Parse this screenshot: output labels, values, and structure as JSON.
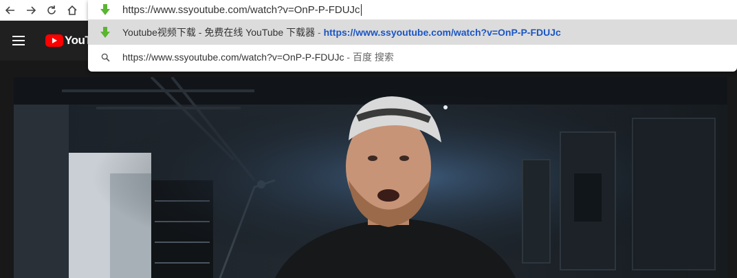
{
  "browser": {
    "nav_icons": [
      "back-arrow-icon",
      "forward-arrow-icon",
      "reload-icon",
      "home-icon"
    ],
    "address_bar": {
      "value": "https://www.ssyoutube.com/watch?v=OnP-P-FDUJc"
    },
    "suggestions": [
      {
        "title": "Youtube视频下载 - 免费在线 YouTube 下载器",
        "separator": " - ",
        "url": "https://www.ssyoutube.com/watch?v=OnP-P-FDUJc",
        "icon": "ssyoutube-favicon",
        "selected": true
      },
      {
        "title": "https://www.ssyoutube.com/watch?v=OnP-P-FDUJc",
        "separator": " - ",
        "engine": "百度 搜索",
        "icon": "search-icon",
        "selected": false
      }
    ]
  },
  "youtube": {
    "logo_text": "YouTu",
    "icons": [
      "menu-icon",
      "youtube-play-icon"
    ]
  },
  "colors": {
    "brand_red": "#ff0000",
    "link_blue": "#1a56c4",
    "favicon_green": "#5ab531"
  }
}
